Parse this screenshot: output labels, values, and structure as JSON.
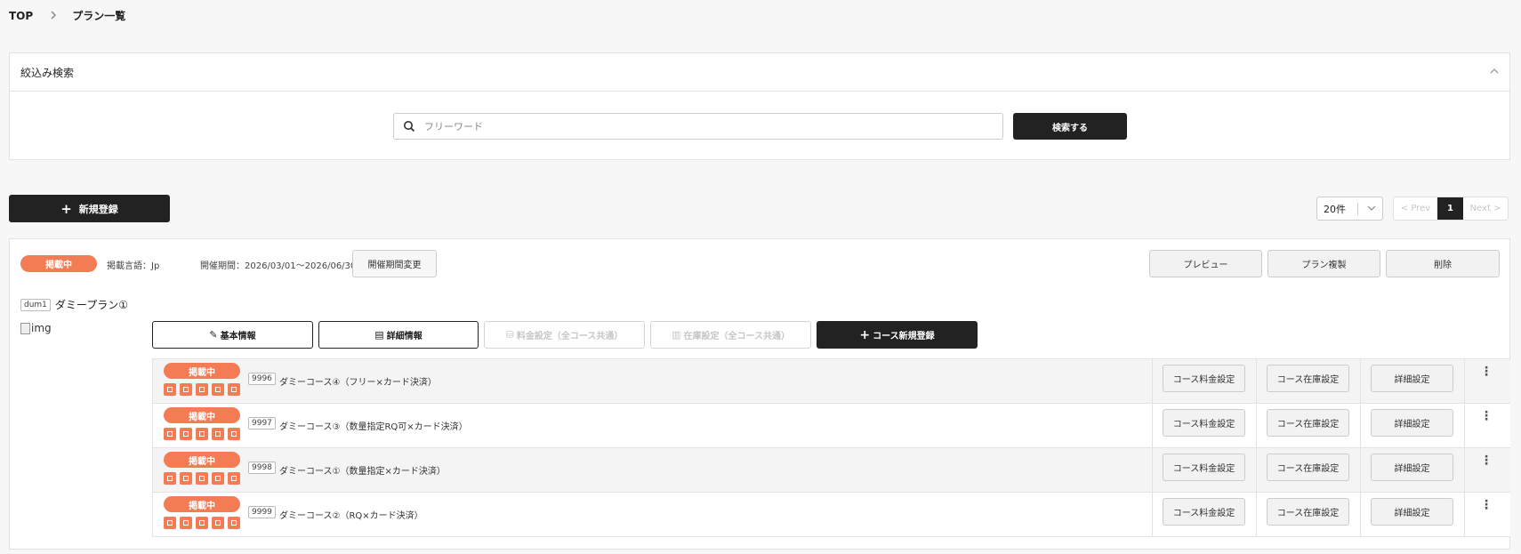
{
  "breadcrumb": {
    "home": "TOP",
    "current": "プラン一覧"
  },
  "filter": {
    "title": "絞込み検索",
    "search_placeholder": "フリーワード",
    "search_button": "検索する"
  },
  "toolbar": {
    "new_button": "新規登録",
    "per_page": "20件",
    "prev": "< Prev",
    "page": "1",
    "next": "Next >"
  },
  "plan": {
    "status": "掲載中",
    "language": "掲載言語：Jp",
    "period": "開催期間：2026/03/01〜2026/06/30",
    "period_change": "開催期間変更",
    "preview": "プレビュー",
    "duplicate": "プラン複製",
    "delete": "削除",
    "code": "dum1",
    "title": "ダミープラン①",
    "image_alt": "img",
    "basic_info": "基本情報",
    "detail_info": "詳細情報",
    "price_common": "料金設定（全コース共通）",
    "stock_common": "在庫設定（全コース共通）",
    "new_course": "コース新規登録",
    "course_price": "コース料金設定",
    "course_stock": "コース在庫設定",
    "course_detail": "詳細設定",
    "courses": [
      {
        "status": "掲載中",
        "code": "9996",
        "name": "ダミーコース④（フリー×カード決済）"
      },
      {
        "status": "掲載中",
        "code": "9997",
        "name": "ダミーコース③（数量指定RQ可×カード決済）"
      },
      {
        "status": "掲載中",
        "code": "9998",
        "name": "ダミーコース①（数量指定×カード決済）"
      },
      {
        "status": "掲載中",
        "code": "9999",
        "name": "ダミーコース②（RQ×カード決済）"
      }
    ]
  },
  "colors": {
    "status": "#f47c54",
    "primary": "#222222"
  }
}
